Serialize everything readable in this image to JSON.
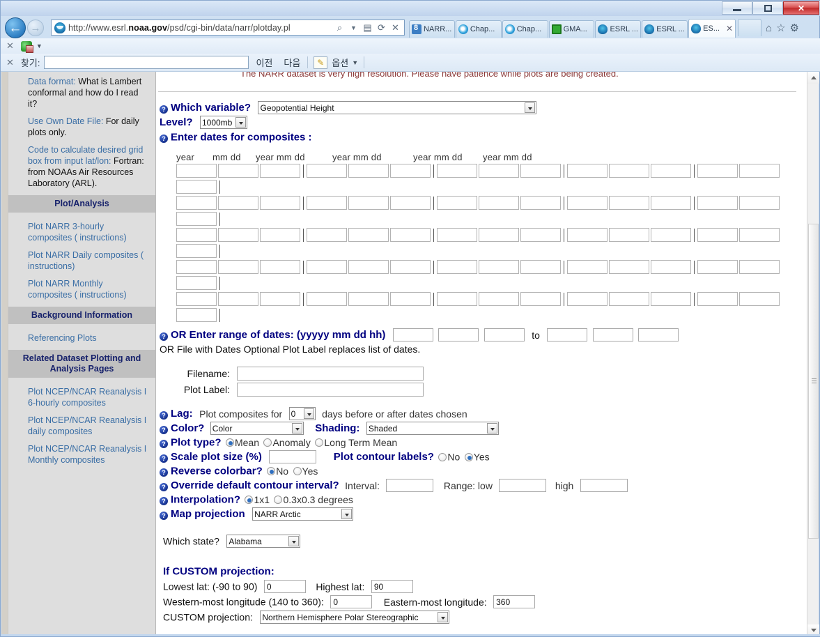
{
  "window": {
    "minimize_label": "Minimize",
    "maximize_label": "Maximize",
    "close_label": "✕"
  },
  "nav": {
    "back_glyph": "←",
    "forward_glyph": "→",
    "url_prefix": "http://www.esrl.",
    "url_bold": "noaa.gov",
    "url_suffix": "/psd/cgi-bin/data/narr/plotday.pl",
    "search_icon": "⌕",
    "compat_icon": "▤",
    "refresh_icon": "⟳",
    "stop_icon": "✕",
    "home_icon": "⌂",
    "favorites_icon": "☆",
    "tools_icon": "⚙"
  },
  "tabs": [
    {
      "label": "NARR...",
      "favicon": "narr-favicon",
      "active": false,
      "closable": false
    },
    {
      "label": "Chap...",
      "favicon": "ie-favicon",
      "active": false,
      "closable": false
    },
    {
      "label": "Chap...",
      "favicon": "ie-favicon",
      "active": false,
      "closable": false
    },
    {
      "label": "GMA...",
      "favicon": "gmail-favicon",
      "active": false,
      "closable": false
    },
    {
      "label": "ESRL ...",
      "favicon": "esrl-favicon",
      "active": false,
      "closable": false
    },
    {
      "label": "ESRL ...",
      "favicon": "esrl-favicon",
      "active": false,
      "closable": false
    },
    {
      "label": "ES...",
      "favicon": "esrl-favicon",
      "active": true,
      "closable": true,
      "close_glyph": "✕"
    }
  ],
  "command_bar": {
    "close_glyph": "✕",
    "caret_glyph": "▼"
  },
  "find_bar": {
    "close_glyph": "✕",
    "label": "찾기:",
    "value": "",
    "previous_label": "이전",
    "next_label": "다음",
    "highlight_icon": "✎",
    "options_label": "옵션",
    "options_caret": "▼"
  },
  "sidebar": {
    "help_items": [
      {
        "link": "Data format:",
        "text": " What is Lambert conformal and how do I read it?"
      },
      {
        "link": "Use Own Date File:",
        "text": " For daily plots only."
      },
      {
        "link": "Code to calculate desired grid box from input lat/lon:",
        "text": " Fortran: from NOAAs Air Resources Laboratory (ARL)."
      }
    ],
    "section_plot_analysis": "Plot/Analysis",
    "plot_links": [
      "Plot NARR 3-hourly composites ( instructions)",
      "Plot NARR Daily composites ( instructions)",
      "Plot NARR Monthly composites ( instructions)"
    ],
    "section_background": "Background Information",
    "background_links": [
      "Referencing Plots"
    ],
    "section_related": "Related Dataset Plotting and Analysis Pages",
    "related_links": [
      "Plot NCEP/NCAR Reanalysis I 6-hourly composites",
      "Plot NCEP/NCAR Reanalysis I daily composites",
      "Plot NCEP/NCAR Reanalysis I Monthly composites"
    ]
  },
  "form": {
    "notice": "The NARR dataset is very high resolution. Please have patience while plots are being created.",
    "variable_label": "Which variable?",
    "variable_value": "Geopotential Height",
    "level_label": "Level?",
    "level_value": "1000mb",
    "dates_label": "Enter dates for composites :",
    "date_headers": [
      "year",
      "mm dd",
      "year mm dd",
      "year mm dd",
      "year mm dd",
      "year mm dd"
    ],
    "date_rows": 5,
    "date_fields_per_row": 15,
    "range_label": "OR Enter range of dates: (yyyyy mm dd hh)",
    "range_to": "to",
    "range_start": [
      "",
      "",
      ""
    ],
    "range_end": [
      "",
      "",
      ""
    ],
    "file_note": "OR File with Dates Optional Plot Label replaces list of dates.",
    "filename_label": "Filename:",
    "filename_value": "",
    "plotlabel_label": "Plot Label:",
    "plotlabel_value": "",
    "lag_label": "Lag:",
    "lag_pre": "Plot composites for",
    "lag_value": "0",
    "lag_post": "days before or after dates chosen",
    "color_label": "Color?",
    "color_value": "Color",
    "shading_label": "Shading:",
    "shading_value": "Shaded",
    "plot_type_label": "Plot type?",
    "plot_type_options": [
      "Mean",
      "Anomaly",
      "Long Term Mean"
    ],
    "plot_type_selected": "Mean",
    "scale_label": "Scale plot size (%)",
    "scale_value": "",
    "contour_labels_label": "Plot contour labels?",
    "contour_labels_options": [
      "No",
      "Yes"
    ],
    "contour_labels_selected": "Yes",
    "reverse_label": "Reverse colorbar?",
    "reverse_options": [
      "No",
      "Yes"
    ],
    "reverse_selected": "No",
    "override_label": "Override default contour interval?",
    "interval_label": "Interval:",
    "interval_value": "",
    "range_low_label": "Range: low",
    "range_low_value": "",
    "range_high_label": "high",
    "range_high_value": "",
    "interpolation_label": "Interpolation?",
    "interpolation_options": [
      "1x1",
      "0.3x0.3 degrees"
    ],
    "interpolation_selected": "1x1",
    "map_projection_label": "Map projection",
    "map_projection_value": "NARR Arctic",
    "which_state_label": "Which state?",
    "which_state_value": "Alabama",
    "custom_heading": "If CUSTOM projection:",
    "lowest_lat_label": "Lowest lat: (-90 to 90)",
    "lowest_lat_value": "0",
    "highest_lat_label": "Highest lat:",
    "highest_lat_value": "90",
    "west_lon_label": "Western-most longitude (140 to 360):",
    "west_lon_value": "0",
    "east_lon_label": "Eastern-most longitude:",
    "east_lon_value": "360",
    "custom_proj_label": "CUSTOM projection:",
    "custom_proj_value": "Northern Hemisphere Polar Stereographic"
  },
  "scrollbar": {
    "up_arrow": "▲",
    "down_arrow": "▼"
  },
  "colors": {
    "heading_blue": "#000080",
    "link_blue": "#3a6ea5",
    "notice_red": "#8b3a3a",
    "sidebar_bg": "#dedede",
    "section_bg": "#c0c0c0"
  }
}
